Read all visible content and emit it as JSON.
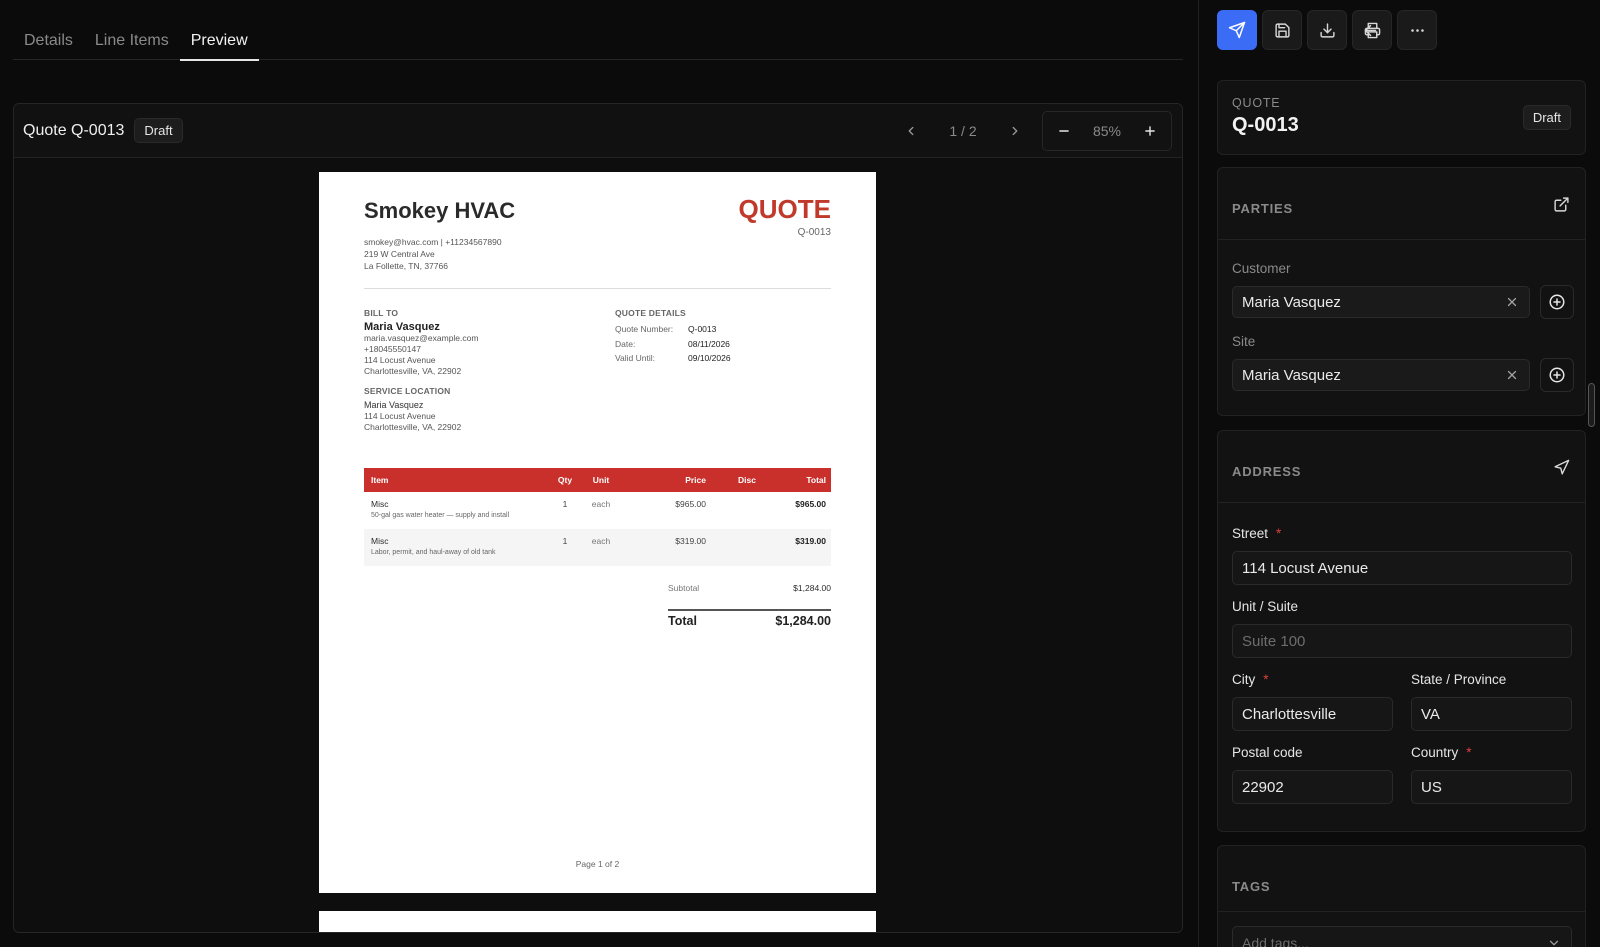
{
  "tabs": [
    {
      "label": "Details",
      "active": false
    },
    {
      "label": "Line Items",
      "active": false
    },
    {
      "label": "Preview",
      "active": true
    }
  ],
  "viewer": {
    "title": "Quote Q-0013",
    "status": "Draft",
    "page_indicator": "1 / 2",
    "zoom": "85%"
  },
  "document": {
    "company_name": "Smokey HVAC",
    "heading": "QUOTE",
    "quote_number": "Q-0013",
    "company_contact": "smokey@hvac.com | +11234567890",
    "company_street": "219 W Central Ave",
    "company_city": "La Follette, TN, 37766",
    "bill_to_label": "BILL TO",
    "bill_to": {
      "name": "Maria Vasquez",
      "email": "maria.vasquez@example.com",
      "phone": "+18045550147",
      "street": "114 Locust Avenue",
      "city": "Charlottesville, VA, 22902"
    },
    "service_location_label": "SERVICE LOCATION",
    "service_location": {
      "name": "Maria Vasquez",
      "street": "114 Locust Avenue",
      "city": "Charlottesville, VA, 22902"
    },
    "quote_details_label": "QUOTE DETAILS",
    "quote_details": {
      "number_label": "Quote Number:",
      "number": "Q-0013",
      "date_label": "Date:",
      "date": "08/11/2026",
      "valid_label": "Valid Until:",
      "valid_until": "09/10/2026"
    },
    "table_headers": {
      "item": "Item",
      "qty": "Qty",
      "unit": "Unit",
      "price": "Price",
      "disc": "Disc",
      "total": "Total"
    },
    "line_items": [
      {
        "item": "Misc",
        "desc": "50-gal gas water heater — supply and install",
        "qty": "1",
        "unit": "each",
        "price": "$965.00",
        "disc": "",
        "total": "$965.00"
      },
      {
        "item": "Misc",
        "desc": "Labor, permit, and haul-away of old tank",
        "qty": "1",
        "unit": "each",
        "price": "$319.00",
        "disc": "",
        "total": "$319.00"
      }
    ],
    "subtotal_label": "Subtotal",
    "subtotal": "$1,284.00",
    "total_label": "Total",
    "total": "$1,284.00",
    "page_footer": "Page 1 of 2"
  },
  "panel": {
    "quote_label": "QUOTE",
    "quote_number": "Q-0013",
    "status": "Draft",
    "parties_label": "PARTIES",
    "customer_label": "Customer",
    "customer_value": "Maria Vasquez",
    "site_label": "Site",
    "site_value": "Maria Vasquez",
    "address_label": "ADDRESS",
    "street_label": "Street",
    "street_value": "114 Locust Avenue",
    "unit_label": "Unit / Suite",
    "unit_placeholder": "Suite 100",
    "city_label": "City",
    "city_value": "Charlottesville",
    "state_label": "State / Province",
    "state_value": "VA",
    "postal_label": "Postal code",
    "postal_value": "22902",
    "country_label": "Country",
    "country_value": "US",
    "tags_label": "TAGS",
    "tags_placeholder": "Add tags..."
  },
  "colors": {
    "accent": "#3b6cf6",
    "quote_red": "#c0392b",
    "table_header": "#c9302c",
    "required": "#e0413a"
  },
  "icons": [
    "send-icon",
    "save-icon",
    "download-icon",
    "print-icon",
    "more-icon",
    "arrow-left-icon",
    "chevron-left-icon",
    "chevron-right-icon",
    "minus-icon",
    "plus-icon",
    "external-link-icon",
    "navigation-icon",
    "close-icon",
    "plus-circle-icon",
    "chevron-down-icon"
  ]
}
